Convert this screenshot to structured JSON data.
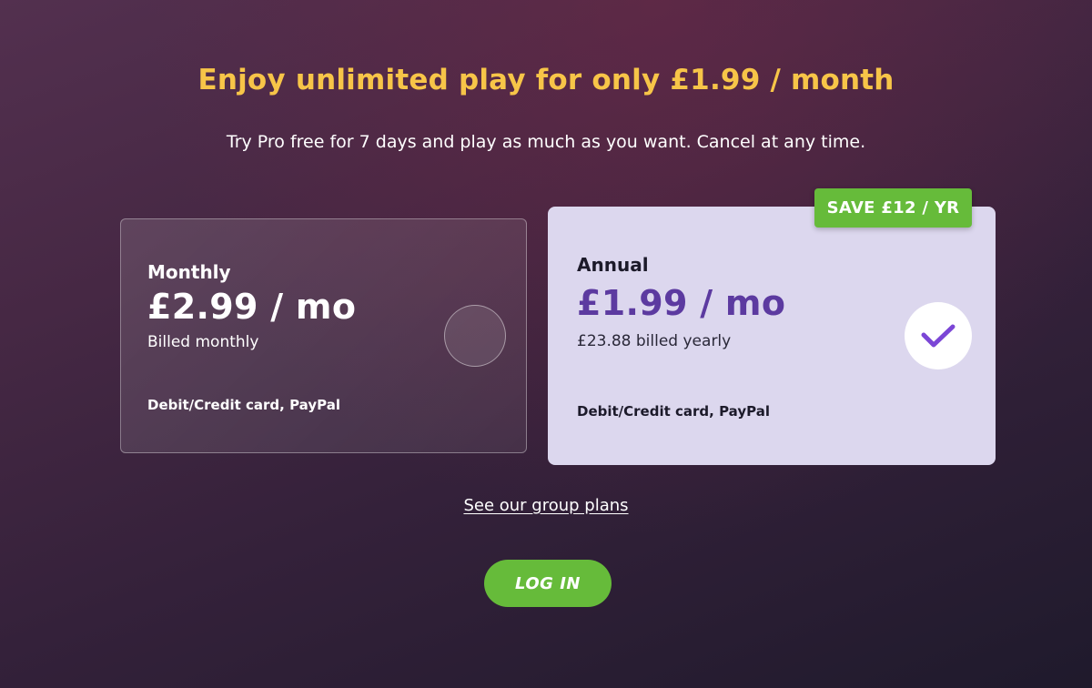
{
  "header": {
    "headline": "Enjoy unlimited play for only £1.99 / month",
    "subheadline": "Try Pro free for 7 days and play as much as you want. Cancel at any time."
  },
  "plans": [
    {
      "name": "Monthly",
      "price": "£2.99 / mo",
      "billing": "Billed monthly",
      "payment_methods": "Debit/Credit card, PayPal",
      "selected": false
    },
    {
      "name": "Annual",
      "price": "£1.99 / mo",
      "billing": "£23.88 billed yearly",
      "payment_methods": "Debit/Credit card, PayPal",
      "selected": true,
      "badge": "SAVE £12 / YR"
    }
  ],
  "links": {
    "group_plans": "See our group plans"
  },
  "actions": {
    "login_label": "LOG IN"
  },
  "colors": {
    "headline": "#f7c548",
    "accent_green": "#66bb3a",
    "selected_card_bg": "#dcd7ee",
    "selected_price": "#5c3aa0",
    "check_icon": "#7b46d6"
  },
  "icons": {
    "selected_indicator": "check-icon"
  }
}
